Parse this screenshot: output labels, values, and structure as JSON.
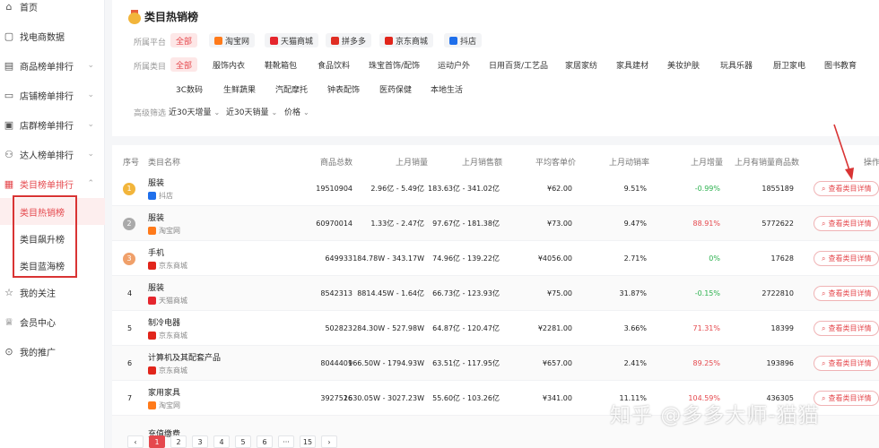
{
  "sidebar": {
    "items": [
      {
        "label": "首页",
        "icon": "home-icon"
      },
      {
        "label": "找电商数据",
        "icon": "search-data-icon"
      },
      {
        "label": "商品榜单排行",
        "icon": "goods-rank-icon"
      },
      {
        "label": "店铺榜单排行",
        "icon": "shop-rank-icon"
      },
      {
        "label": "店群榜单排行",
        "icon": "shop-group-icon"
      },
      {
        "label": "达人榜单排行",
        "icon": "influencer-icon"
      },
      {
        "label": "类目榜单排行",
        "icon": "category-rank-icon"
      },
      {
        "label": "我的关注",
        "icon": "star-icon"
      },
      {
        "label": "会员中心",
        "icon": "vip-icon"
      },
      {
        "label": "我的推广",
        "icon": "promote-icon"
      }
    ],
    "subitems": [
      {
        "label": "类目热销榜"
      },
      {
        "label": "类目飙升榜"
      },
      {
        "label": "类目蓝海榜"
      }
    ]
  },
  "filter": {
    "title": "类目热销榜",
    "platform_label": "所属平台",
    "platforms": [
      {
        "label": "全部",
        "color": ""
      },
      {
        "label": "淘宝网",
        "color": "#ff7a1a"
      },
      {
        "label": "天猫商城",
        "color": "#e5262d"
      },
      {
        "label": "拼多多",
        "color": "#e02e24"
      },
      {
        "label": "京东商城",
        "color": "#e1251b"
      },
      {
        "label": "抖店",
        "color": "#1f6feb"
      }
    ],
    "category_label": "所属类目",
    "categories": [
      "全部",
      "服饰内衣",
      "鞋靴箱包",
      "食品饮料",
      "珠宝首饰/配饰",
      "运动户外",
      "日用百货/工艺品",
      "家居家纺",
      "家具建材",
      "美妆护肤",
      "玩具乐器",
      "厨卫家电",
      "图书教育",
      "3C数码",
      "生鲜蔬果",
      "汽配摩托",
      "钟表配饰",
      "医药保健",
      "本地生活"
    ],
    "advanced_label": "高级筛选",
    "advanced": [
      "近30天增量",
      "近30天销量",
      "价格"
    ]
  },
  "table": {
    "headers": [
      "序号",
      "类目名称",
      "商品总数",
      "上月销量",
      "上月销售额",
      "平均客单价",
      "上月动销率",
      "上月增量",
      "上月有销量商品数",
      "操作"
    ],
    "detail_label": "查看类目详情",
    "rows": [
      {
        "rank": "1",
        "name": "服装",
        "platform": "抖店",
        "pcolor": "#1f6feb",
        "total": "19510904",
        "sales": "2.96亿 - 5.49亿",
        "amount": "183.63亿 - 341.02亿",
        "price": "¥62.00",
        "rate": "9.51%",
        "growth": "-0.99%",
        "gcolor": "green",
        "sold": "1855189"
      },
      {
        "rank": "2",
        "name": "服装",
        "platform": "淘宝网",
        "pcolor": "#ff7a1a",
        "total": "60970014",
        "sales": "1.33亿 - 2.47亿",
        "amount": "97.67亿 - 181.38亿",
        "price": "¥73.00",
        "rate": "9.47%",
        "growth": "88.91%",
        "gcolor": "red",
        "sold": "5772622"
      },
      {
        "rank": "3",
        "name": "手机",
        "platform": "京东商城",
        "pcolor": "#e1251b",
        "total": "649933",
        "sales": "184.78W - 343.17W",
        "amount": "74.96亿 - 139.22亿",
        "price": "¥4056.00",
        "rate": "2.71%",
        "growth": "0%",
        "gcolor": "green",
        "sold": "17628"
      },
      {
        "rank": "4",
        "name": "服装",
        "platform": "天猫商城",
        "pcolor": "#e5262d",
        "total": "8542313",
        "sales": "8814.45W - 1.64亿",
        "amount": "66.73亿 - 123.93亿",
        "price": "¥75.00",
        "rate": "31.87%",
        "growth": "-0.15%",
        "gcolor": "green",
        "sold": "2722810"
      },
      {
        "rank": "5",
        "name": "制冷电器",
        "platform": "京东商城",
        "pcolor": "#e1251b",
        "total": "502823",
        "sales": "284.30W - 527.98W",
        "amount": "64.87亿 - 120.47亿",
        "price": "¥2281.00",
        "rate": "3.66%",
        "growth": "71.31%",
        "gcolor": "red",
        "sold": "18399"
      },
      {
        "rank": "6",
        "name": "计算机及其配套产品",
        "platform": "京东商城",
        "pcolor": "#e1251b",
        "total": "8044401",
        "sales": "966.50W - 1794.93W",
        "amount": "63.51亿 - 117.95亿",
        "price": "¥657.00",
        "rate": "2.41%",
        "growth": "89.25%",
        "gcolor": "red",
        "sold": "193896"
      },
      {
        "rank": "7",
        "name": "家用家具",
        "platform": "淘宝网",
        "pcolor": "#ff7a1a",
        "total": "3927526",
        "sales": "1630.05W - 3027.23W",
        "amount": "55.60亿 - 103.26亿",
        "price": "¥341.00",
        "rate": "11.11%",
        "growth": "104.59%",
        "gcolor": "red",
        "sold": "436305"
      },
      {
        "rank": "",
        "name": "充值缴费",
        "platform": "",
        "pcolor": "",
        "total": "",
        "sales": "",
        "amount": "",
        "price": "",
        "rate": "",
        "growth": "",
        "gcolor": "red",
        "sold": ""
      }
    ]
  },
  "pagination": {
    "pages": [
      "1",
      "2",
      "3",
      "4",
      "5",
      "6",
      "···",
      "15"
    ],
    "prev": "‹",
    "next": "›"
  },
  "watermark": "知乎 @多多大师-猫猫",
  "colors": {
    "accent": "#e5484d",
    "gold": "#f2b53b",
    "silver": "#aaaaaa",
    "bronze": "#f0a06a",
    "annotation": "#d93434"
  }
}
